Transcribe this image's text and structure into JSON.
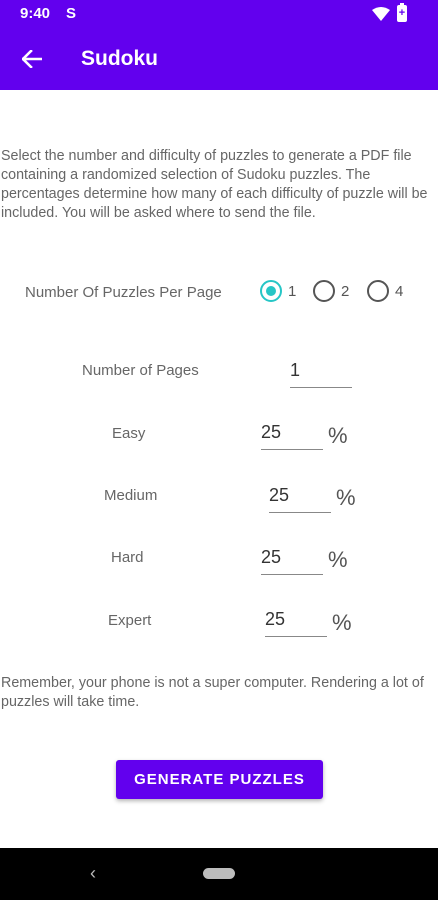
{
  "status_bar": {
    "time": "9:40",
    "notification_icon": "S"
  },
  "app_bar": {
    "title": "Sudoku"
  },
  "intro": "Select the number and difficulty of puzzles to generate a PDF file containing a randomized selection of Sudoku puzzles.  The percentages determine how many of each difficulty of puzzle will be included.  You will be asked where to send the file.",
  "puzzles_per_page": {
    "label": "Number Of Puzzles Per Page",
    "options": [
      {
        "label": "1",
        "selected": true
      },
      {
        "label": "2",
        "selected": false
      },
      {
        "label": "4",
        "selected": false
      }
    ]
  },
  "pages": {
    "label": "Number of Pages",
    "value": "1"
  },
  "difficulties": [
    {
      "label": "Easy",
      "value": "25",
      "unit": "%"
    },
    {
      "label": "Medium",
      "value": "25",
      "unit": "%"
    },
    {
      "label": "Hard",
      "value": "25",
      "unit": "%"
    },
    {
      "label": "Expert",
      "value": "25",
      "unit": "%"
    }
  ],
  "reminder": "Remember, your phone is not a super computer. Rendering a lot of puzzles will take time.",
  "generate_button": "GENERATE PUZZLES",
  "colors": {
    "primary": "#6200ee",
    "accent": "#26c6c6"
  }
}
